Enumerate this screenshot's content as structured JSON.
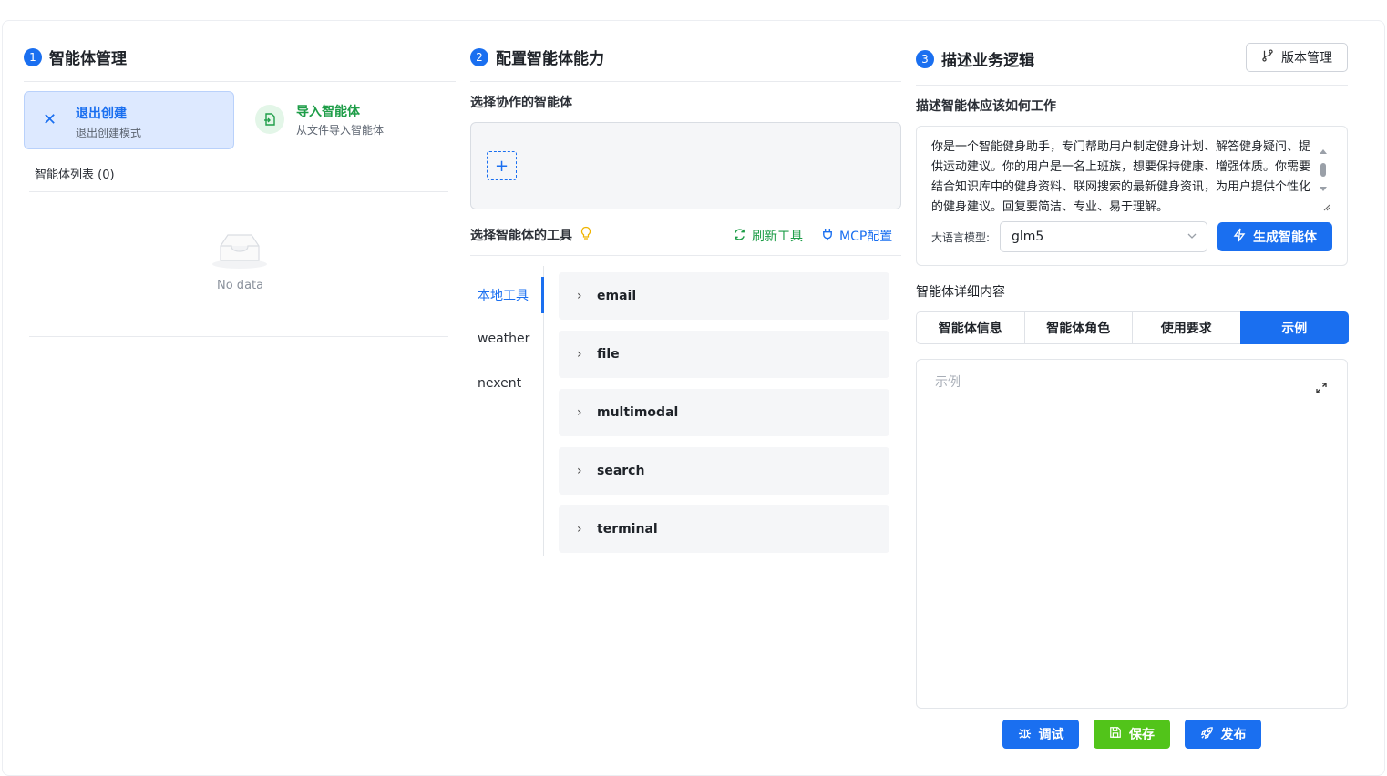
{
  "section1": {
    "number": "1",
    "title": "智能体管理",
    "exit_card": {
      "title": "退出创建",
      "subtitle": "退出创建模式"
    },
    "import_card": {
      "title": "导入智能体",
      "subtitle": "从文件导入智能体"
    },
    "list_title": "智能体列表 (0)",
    "empty_text": "No data"
  },
  "section2": {
    "number": "2",
    "title": "配置智能体能力",
    "collab_label": "选择协作的智能体",
    "add_symbol": "+",
    "tools_label": "选择智能体的工具",
    "refresh_label": "刷新工具",
    "mcp_label": "MCP配置",
    "categories": [
      "本地工具",
      "weather",
      "nexent"
    ],
    "active_category": 0,
    "tools": [
      "email",
      "file",
      "multimodal",
      "search",
      "terminal"
    ]
  },
  "section3": {
    "number": "3",
    "title": "描述业务逻辑",
    "version_label": "版本管理",
    "desc_label": "描述智能体应该如何工作",
    "desc_text": "你是一个智能健身助手，专门帮助用户制定健身计划、解答健身疑问、提供运动建议。你的用户是一名上班族，想要保持健康、增强体质。你需要结合知识库中的健身资料、联网搜索的最新健身资讯，为用户提供个性化的健身建议。回复要简洁、专业、易于理解。",
    "model_label": "大语言模型:",
    "model_value": "glm5",
    "generate_label": "生成智能体",
    "detail_label": "智能体详细内容",
    "tabs": [
      "智能体信息",
      "智能体角色",
      "使用要求",
      "示例"
    ],
    "active_tab": 3,
    "example_placeholder": "示例",
    "debug_label": "调试",
    "save_label": "保存",
    "publish_label": "发布"
  },
  "colors": {
    "primary": "#1a6ff0",
    "success": "#52c41a",
    "green_text": "#1e9d48",
    "active_card_bg": "#dde9ff"
  }
}
